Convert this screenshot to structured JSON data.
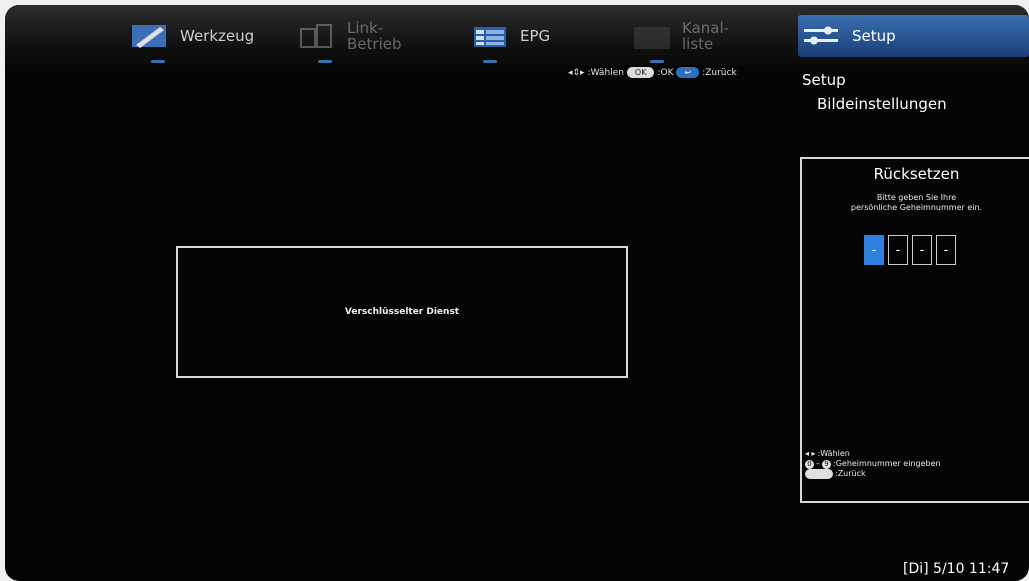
{
  "menu": {
    "werkzeug": "Werkzeug",
    "link": "Link-\nBetrieb",
    "epg": "EPG",
    "kanal": "Kanal-\nliste",
    "setup": "Setup"
  },
  "hints": {
    "select": ":Wählen",
    "ok_key": "OK",
    "ok": ":OK",
    "back": ":Zurück"
  },
  "breadcrumb": {
    "title": "Setup",
    "subtitle": "Bildeinstellungen"
  },
  "dialog": {
    "message": "Verschlüsselter Dienst"
  },
  "reset_panel": {
    "title": "Rücksetzen",
    "message": "Bitte geben Sie Ihre\npersönliche Geheimnummer ein.",
    "pin": [
      "-",
      "-",
      "-",
      "-"
    ],
    "legend": {
      "select": ":Wählen",
      "key_from": "0",
      "key_to": "9",
      "enter": ":Geheimnummer eingeben",
      "back": ":Zurück"
    }
  },
  "status": {
    "datetime": "[Di] 5/10 11:47"
  },
  "colors": {
    "accent": "#2f7fe0",
    "background": "#050505"
  }
}
